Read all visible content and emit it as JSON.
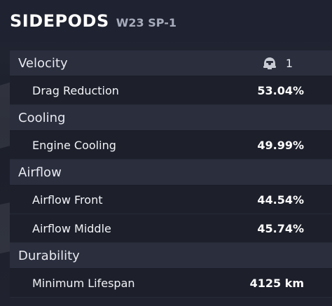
{
  "header": {
    "title": "SIDEPODS",
    "subtitle": "W23 SP-1"
  },
  "categories": [
    {
      "label": "Velocity",
      "level": "1",
      "level_icon": "driver-helmet-icon",
      "stats": [
        {
          "label": "Drag Reduction",
          "value": "53.04%"
        }
      ]
    },
    {
      "label": "Cooling",
      "stats": [
        {
          "label": "Engine Cooling",
          "value": "49.99%"
        }
      ]
    },
    {
      "label": "Airflow",
      "stats": [
        {
          "label": "Airflow Front",
          "value": "44.54%"
        },
        {
          "label": "Airflow Middle",
          "value": "45.74%"
        }
      ]
    },
    {
      "label": "Durability",
      "stats": [
        {
          "label": "Minimum Lifespan",
          "value": "4125 km"
        }
      ]
    }
  ]
}
